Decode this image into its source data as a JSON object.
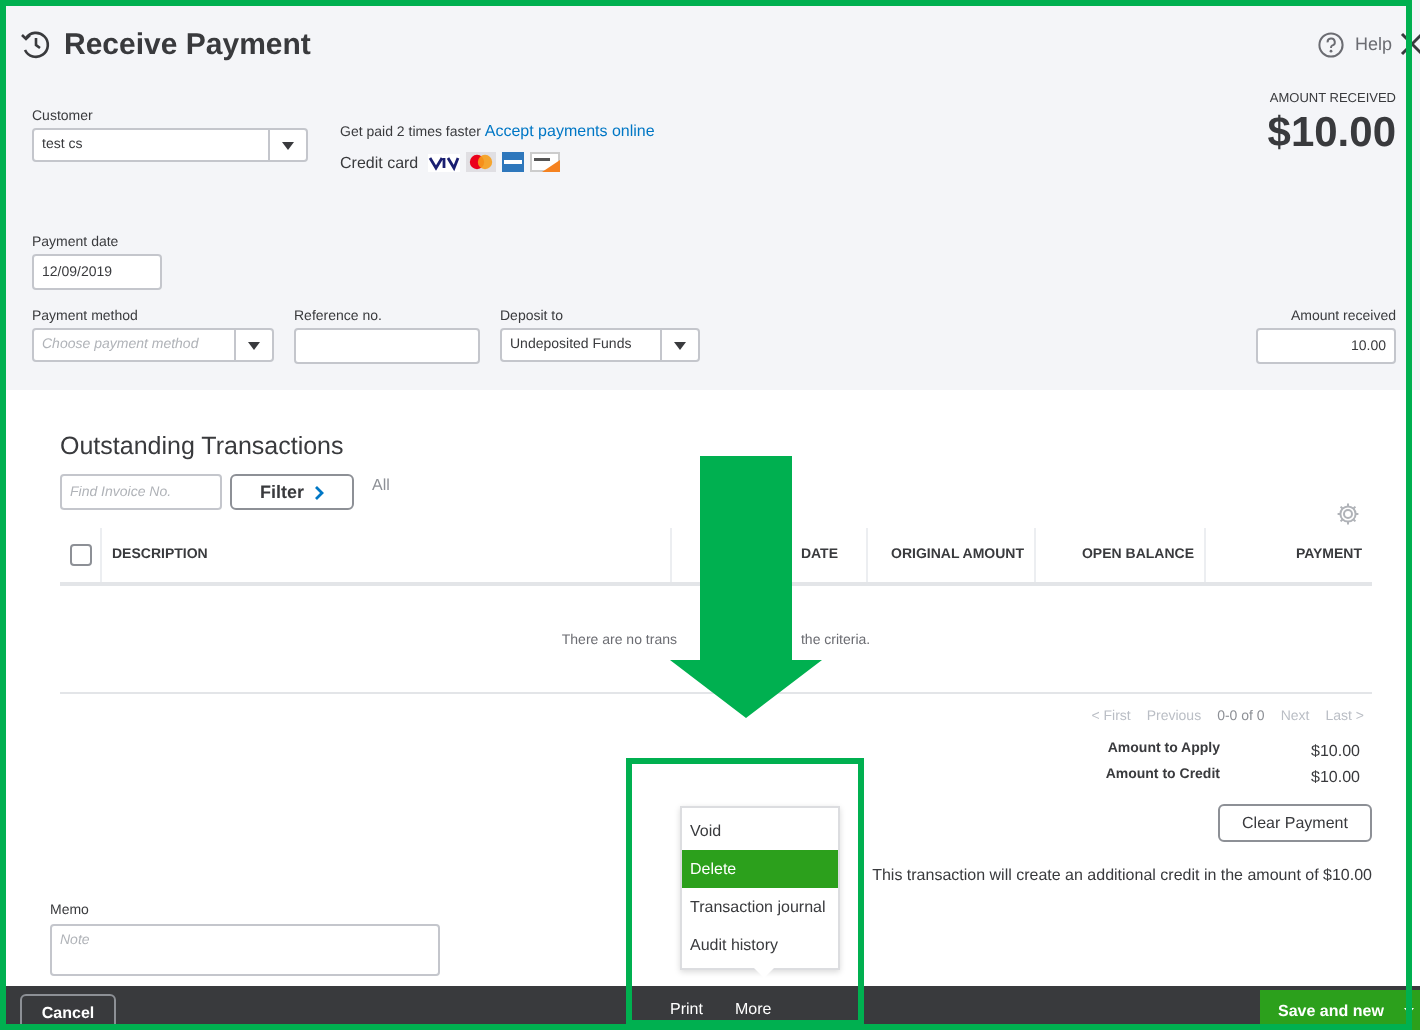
{
  "window": {
    "title": "Receive Payment",
    "help": "Help"
  },
  "customer": {
    "label": "Customer",
    "value": "test cs"
  },
  "promo": {
    "text": "Get paid 2 times faster",
    "link": "Accept payments online",
    "cards_label": "Credit card"
  },
  "amount_summary": {
    "label": "AMOUNT RECEIVED",
    "value": "$10.00"
  },
  "payment_date": {
    "label": "Payment date",
    "value": "12/09/2019"
  },
  "payment_method": {
    "label": "Payment method",
    "placeholder": "Choose payment method"
  },
  "reference_no": {
    "label": "Reference no."
  },
  "deposit_to": {
    "label": "Deposit to",
    "value": "Undeposited Funds"
  },
  "amount_received": {
    "label": "Amount received",
    "value": "10.00"
  },
  "outstanding": {
    "title": "Outstanding Transactions",
    "search_placeholder": "Find Invoice No.",
    "filter_button": "Filter",
    "filter_value": "All",
    "select_all_checked": false,
    "columns": [
      "DESCRIPTION",
      "DATE",
      "ORIGINAL AMOUNT",
      "OPEN BALANCE",
      "PAYMENT"
    ],
    "empty_message": [
      "There are no trans",
      "the criteria."
    ],
    "pagination": [
      "< First",
      "Previous",
      "0-0 of 0",
      "Next",
      "Last >"
    ]
  },
  "totals": [
    {
      "label": "Amount to Apply",
      "value": "$10.00"
    },
    {
      "label": "Amount to Credit",
      "value": "$10.00"
    }
  ],
  "clear_button": "Clear Payment",
  "credit_note": "This transaction will create an additional credit in the amount of $10.00",
  "memo": {
    "label": "Memo",
    "placeholder": "Note"
  },
  "footer": {
    "cancel": "Cancel",
    "print": "Print",
    "more": "More",
    "save": "Save and new"
  },
  "more_menu": [
    {
      "label": "Void",
      "selected": false
    },
    {
      "label": "Delete",
      "selected": true
    },
    {
      "label": "Transaction journal",
      "selected": false
    },
    {
      "label": "Audit history",
      "selected": false
    }
  ]
}
